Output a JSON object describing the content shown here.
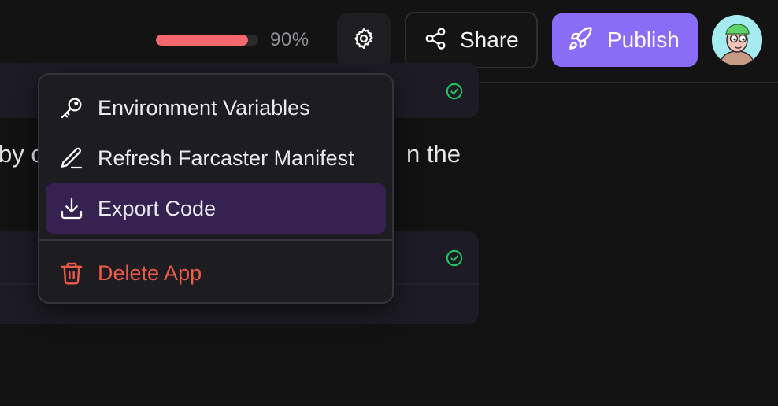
{
  "header": {
    "progress": {
      "value": 0.9,
      "label": "90%"
    },
    "settings": {
      "icon": "gear-icon"
    },
    "share": {
      "label": "Share",
      "icon": "share-icon"
    },
    "publish": {
      "label": "Publish",
      "icon": "rocket-icon"
    },
    "avatar": {
      "icon": "avatar"
    }
  },
  "background": {
    "text_left": "by c",
    "text_right": "n the"
  },
  "menu": {
    "items": [
      {
        "label": "Environment Variables",
        "icon": "key-icon"
      },
      {
        "label": "Refresh Farcaster Manifest",
        "icon": "pencil-icon"
      },
      {
        "label": "Export Code",
        "icon": "download-icon",
        "active": true
      },
      {
        "label": "Delete App",
        "icon": "trash-icon",
        "danger": true
      }
    ]
  },
  "colors": {
    "accent": "#8b6cf7",
    "progress": "#f3686d",
    "danger": "#ef5a48",
    "active_item": "#362250",
    "success": "#22c55e"
  }
}
